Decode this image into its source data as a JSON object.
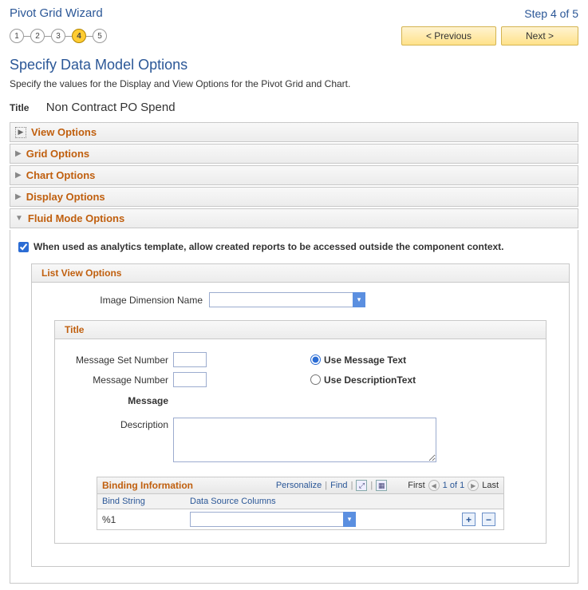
{
  "header": {
    "wizard_title": "Pivot Grid Wizard",
    "step_indicator": "Step 4 of 5"
  },
  "steps": [
    "1",
    "2",
    "3",
    "4",
    "5"
  ],
  "active_step_index": 3,
  "nav": {
    "previous": "< Previous",
    "next": "Next >"
  },
  "section": {
    "title": "Specify Data Model Options",
    "desc": "Specify the values for the Display and View Options for the Pivot Grid and Chart."
  },
  "title_field": {
    "label": "Title",
    "value": "Non Contract PO Spend"
  },
  "accordions": {
    "view_options": "View Options",
    "grid_options": "Grid Options",
    "chart_options": "Chart Options",
    "display_options": "Display Options",
    "fluid_mode_options": "Fluid Mode Options"
  },
  "fluid": {
    "checkbox_label": "When used as analytics template, allow created reports to be accessed outside the component context.",
    "checkbox_checked": true,
    "list_view_options": {
      "title": "List View Options",
      "image_dimension_label": "Image Dimension Name",
      "image_dimension_value": ""
    },
    "title_panel": {
      "header": "Title",
      "msg_set_label": "Message Set Number",
      "msg_set_value": "",
      "msg_num_label": "Message Number",
      "msg_num_value": "",
      "radio_use_msg": "Use Message Text",
      "radio_use_desc": "Use DescriptionText",
      "radio_selected": "msg",
      "message_label": "Message",
      "description_label": "Description",
      "description_value": ""
    },
    "binding_grid": {
      "title": "Binding Information",
      "personalize": "Personalize",
      "find": "Find",
      "first": "First",
      "last": "Last",
      "page_info": "1 of 1",
      "col_bind_string": "Bind String",
      "col_data_source": "Data Source Columns",
      "row": {
        "bind_string": "%1",
        "data_source_value": ""
      }
    }
  }
}
